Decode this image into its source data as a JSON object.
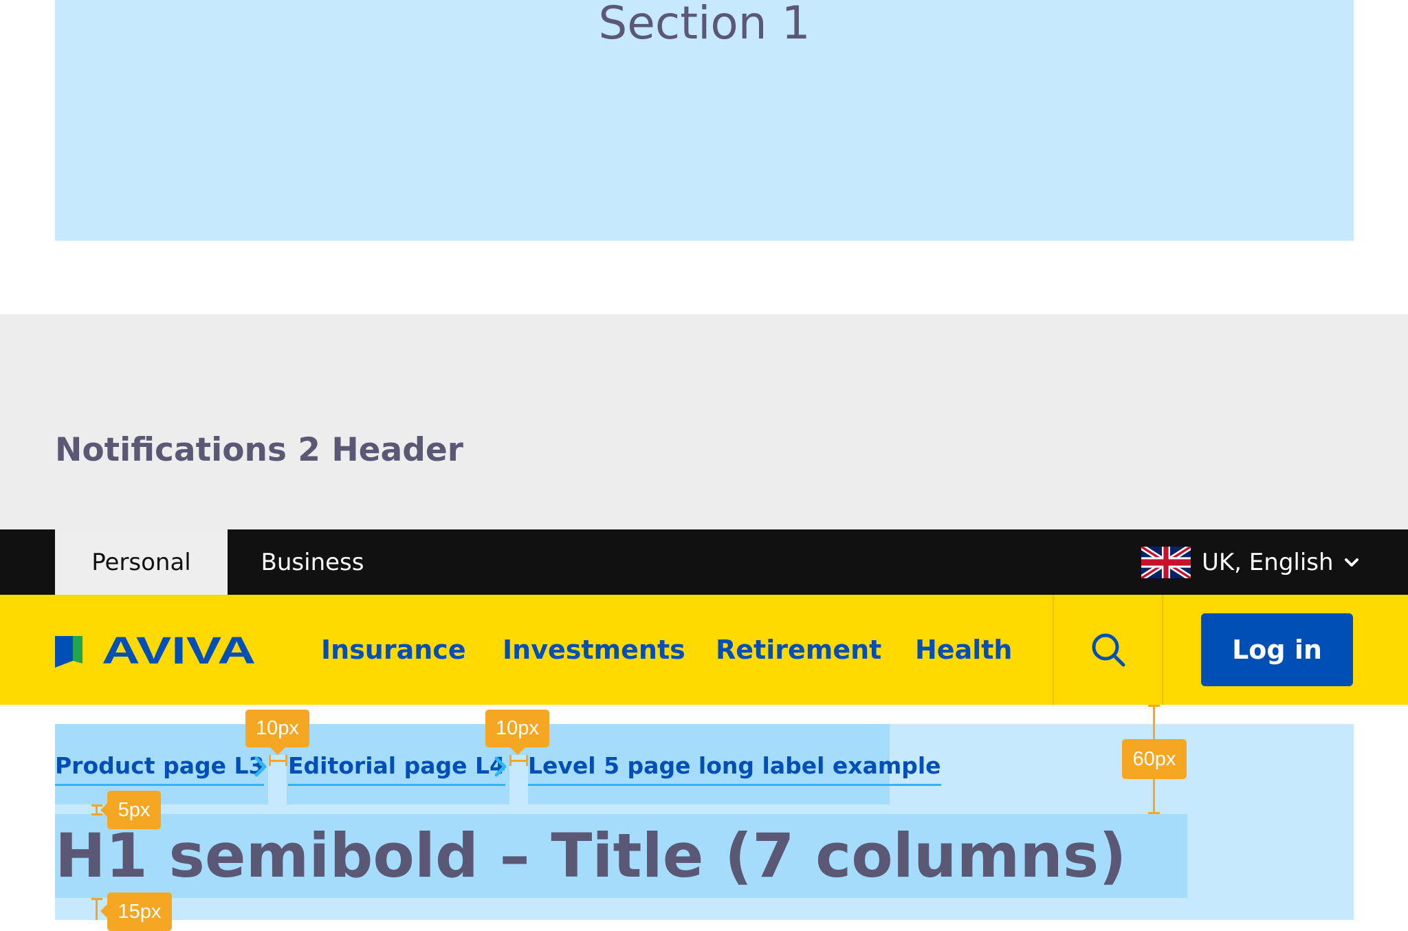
{
  "section1": {
    "title": "Section 1"
  },
  "notifications": {
    "title": "Notifications 2 Header"
  },
  "topbar": {
    "tabs": [
      {
        "label": "Personal",
        "active": true
      },
      {
        "label": "Business",
        "active": false
      }
    ],
    "region": {
      "label": "UK, English",
      "flag_icon": "uk-flag-icon",
      "chevron_icon": "chevron-down-icon"
    }
  },
  "navbar": {
    "logo": "AVIVA",
    "links": [
      "Insurance",
      "Investments",
      "Retirement",
      "Health"
    ],
    "search_icon": "search-icon",
    "login_label": "Log in"
  },
  "breadcrumb": {
    "items": [
      "Product page L3",
      "Editorial page L4",
      "Level 5 page long label example"
    ],
    "separator_icon": "chevron-right-icon"
  },
  "page": {
    "title": "H1 semibold – Title (7 columns)"
  },
  "annotations": {
    "gap_1": "10px",
    "gap_2": "10px",
    "top_spacing": "60px",
    "breadcrumb_title_gap": "5px",
    "title_bottom_gap": "15px"
  },
  "colors": {
    "brand_yellow": "#ffd900",
    "brand_blue": "#004fb6",
    "top_bar": "#111111",
    "section_fill": "#c7e9fd",
    "annotation": "#f5a623",
    "heading_text": "#5a5874"
  }
}
